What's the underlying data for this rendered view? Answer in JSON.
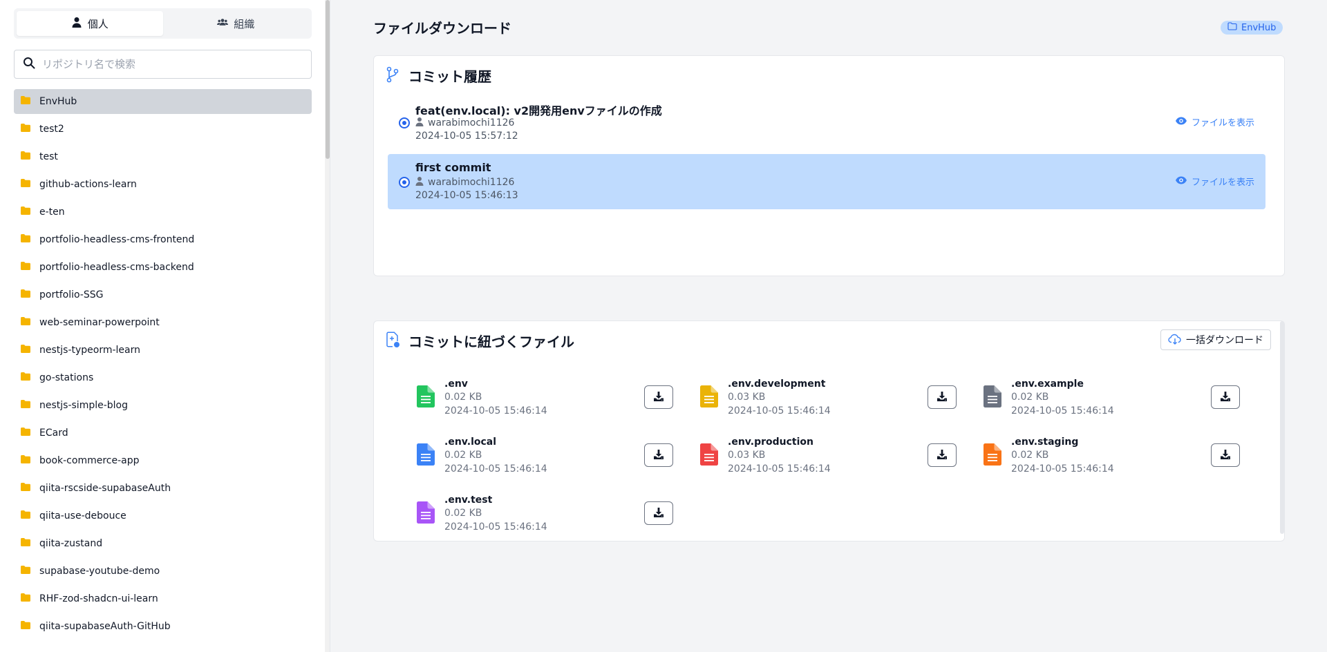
{
  "colors": {
    "accent": "#3b82f6",
    "selected_commit_bg": "#bfdbfe",
    "selected_repo_bg": "#d1d5db",
    "folder": "#f5b400"
  },
  "sidebar": {
    "tabs": [
      {
        "label": "個人",
        "icon": "user-icon",
        "active": true
      },
      {
        "label": "組織",
        "icon": "users-icon",
        "active": false
      }
    ],
    "search": {
      "placeholder": "リポジトリ名で検索",
      "value": ""
    },
    "repositories": [
      "EnvHub",
      "test2",
      "test",
      "github-actions-learn",
      "e-ten",
      "portfolio-headless-cms-frontend",
      "portfolio-headless-cms-backend",
      "portfolio-SSG",
      "web-seminar-powerpoint",
      "nestjs-typeorm-learn",
      "go-stations",
      "nestjs-simple-blog",
      "ECard",
      "book-commerce-app",
      "qiita-rscside-supabaseAuth",
      "qiita-use-debouce",
      "qiita-zustand",
      "supabase-youtube-demo",
      "RHF-zod-shadcn-ui-learn",
      "qiita-supabaseAuth-GitHub"
    ],
    "selected_repository": "EnvHub"
  },
  "main": {
    "title": "ファイルダウンロード",
    "repo_badge": "EnvHub",
    "commits_section": {
      "title": "コミット履歴",
      "view_label": "ファイルを表示",
      "commits": [
        {
          "message": "feat(env.local): v2開発用envファイルの作成",
          "author": "warabimochi1126",
          "date": "2024-10-05 15:57:12",
          "selected": false
        },
        {
          "message": "first commit",
          "author": "warabimochi1126",
          "date": "2024-10-05 15:46:13",
          "selected": true
        }
      ]
    },
    "files_section": {
      "title": "コミットに紐づくファイル",
      "bulk_download_label": "一括ダウンロード",
      "files": [
        {
          "name": ".env",
          "size": "0.02 KB",
          "date": "2024-10-05 15:46:14",
          "color": "#22c55e"
        },
        {
          "name": ".env.development",
          "size": "0.03 KB",
          "date": "2024-10-05 15:46:14",
          "color": "#eab308"
        },
        {
          "name": ".env.example",
          "size": "0.02 KB",
          "date": "2024-10-05 15:46:14",
          "color": "#6b7280"
        },
        {
          "name": ".env.local",
          "size": "0.02 KB",
          "date": "2024-10-05 15:46:14",
          "color": "#3b82f6"
        },
        {
          "name": ".env.production",
          "size": "0.03 KB",
          "date": "2024-10-05 15:46:14",
          "color": "#ef4444"
        },
        {
          "name": ".env.staging",
          "size": "0.02 KB",
          "date": "2024-10-05 15:46:14",
          "color": "#f97316"
        },
        {
          "name": ".env.test",
          "size": "0.02 KB",
          "date": "2024-10-05 15:46:14",
          "color": "#a855f7"
        }
      ]
    }
  }
}
